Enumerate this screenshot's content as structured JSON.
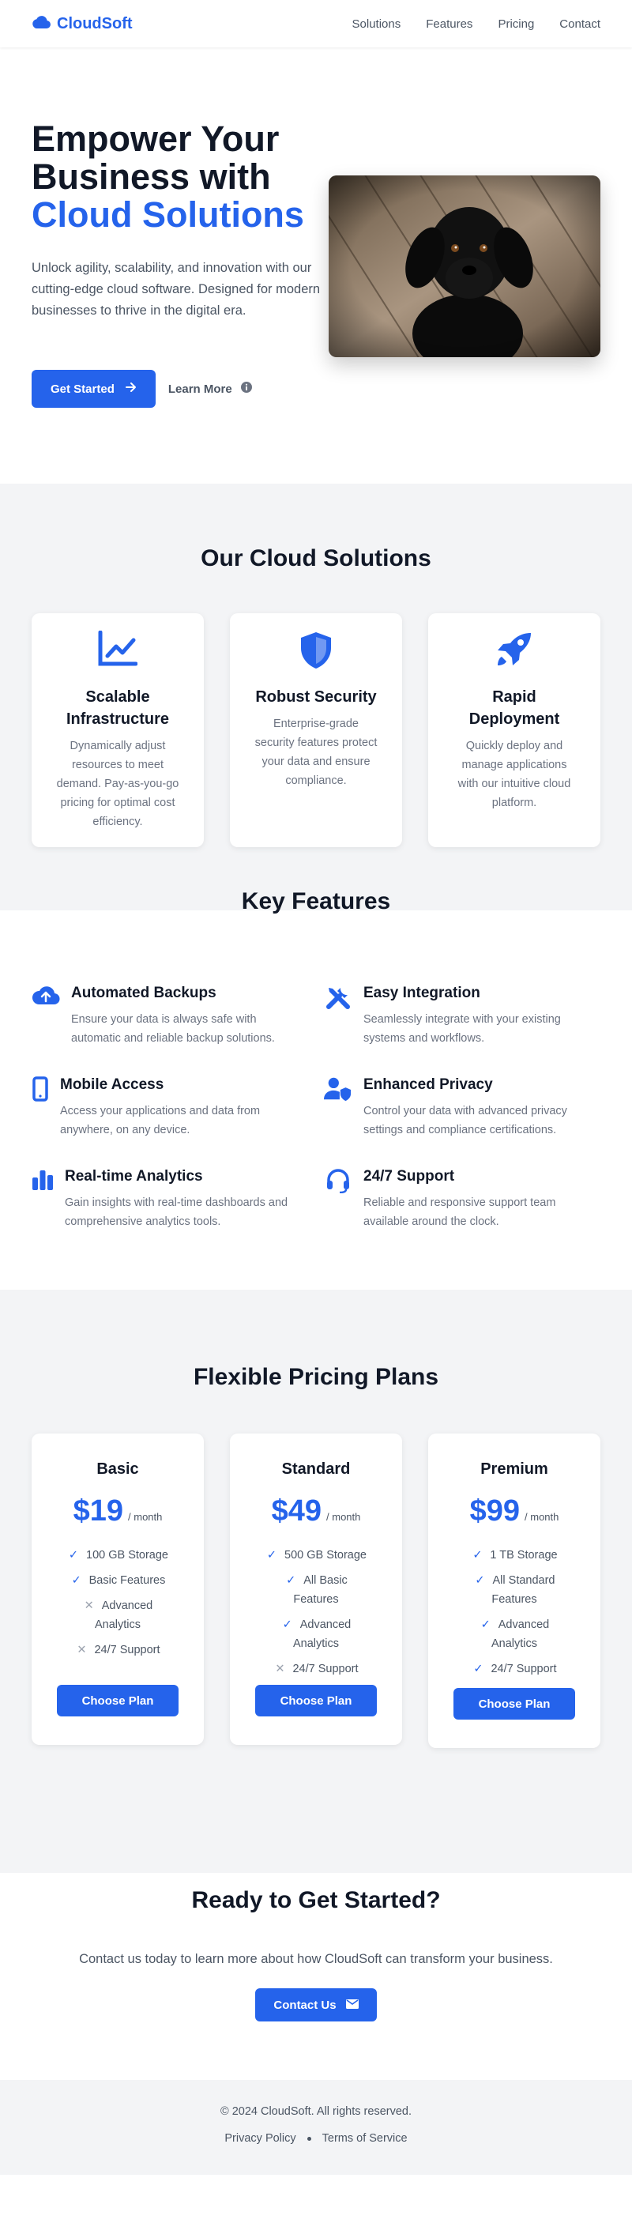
{
  "brand": {
    "name": "CloudSoft"
  },
  "nav": {
    "items": [
      "Solutions",
      "Features",
      "Pricing",
      "Contact"
    ]
  },
  "hero": {
    "title_line1": "Empower Your",
    "title_line2": "Business with",
    "title_accent": "Cloud Solutions",
    "description": "Unlock agility, scalability, and innovation with our cutting-edge cloud software. Designed for modern businesses to thrive in the digital era.",
    "primary_button": "Get Started",
    "secondary_button": "Learn More"
  },
  "solutions": {
    "title": "Our Cloud Solutions",
    "cards": [
      {
        "icon": "chart-line-icon",
        "title": "Scalable Infrastructure",
        "text": "Dynamically adjust resources to meet demand. Pay-as-you-go pricing for optimal cost efficiency."
      },
      {
        "icon": "shield-icon",
        "title": "Robust Security",
        "text": "Enterprise-grade security features protect your data and ensure compliance."
      },
      {
        "icon": "rocket-icon",
        "title": "Rapid Deployment",
        "text": "Quickly deploy and manage applications with our intuitive cloud platform."
      }
    ]
  },
  "features": {
    "title": "Key Features",
    "items": [
      {
        "icon": "cloud-upload-icon",
        "title": "Automated Backups",
        "text": "Ensure your data is always safe with automatic and reliable backup solutions."
      },
      {
        "icon": "tools-icon",
        "title": "Easy Integration",
        "text": "Seamlessly integrate with your existing systems and workflows."
      },
      {
        "icon": "mobile-icon",
        "title": "Mobile Access",
        "text": "Access your applications and data from anywhere, on any device."
      },
      {
        "icon": "user-shield-icon",
        "title": "Enhanced Privacy",
        "text": "Control your data with advanced privacy settings and compliance certifications."
      },
      {
        "icon": "bar-chart-icon",
        "title": "Real-time Analytics",
        "text": "Gain insights with real-time dashboards and comprehensive analytics tools."
      },
      {
        "icon": "headset-icon",
        "title": "24/7 Support",
        "text": "Reliable and responsive support team available around the clock."
      }
    ]
  },
  "pricing": {
    "title": "Flexible Pricing Plans",
    "unit": "/ month",
    "button": "Choose Plan",
    "plans": [
      {
        "name": "Basic",
        "price": "$19",
        "features": [
          {
            "text": "100 GB Storage",
            "included": true
          },
          {
            "text": "Basic Features",
            "included": true
          },
          {
            "text": "Advanced Analytics",
            "included": false
          },
          {
            "text": "24/7 Support",
            "included": false
          }
        ]
      },
      {
        "name": "Standard",
        "price": "$49",
        "features": [
          {
            "text": "500 GB Storage",
            "included": true
          },
          {
            "text": "All Basic Features",
            "included": true
          },
          {
            "text": "Advanced Analytics",
            "included": true
          },
          {
            "text": "24/7 Support",
            "included": false
          }
        ]
      },
      {
        "name": "Premium",
        "price": "$99",
        "features": [
          {
            "text": "1 TB Storage",
            "included": true
          },
          {
            "text": "All Standard Features",
            "included": true
          },
          {
            "text": "Advanced Analytics",
            "included": true
          },
          {
            "text": "24/7 Support",
            "included": true
          }
        ]
      }
    ]
  },
  "cta": {
    "title": "Ready to Get Started?",
    "description": "Contact us today to learn more about how CloudSoft can transform your business.",
    "button": "Contact Us"
  },
  "footer": {
    "copyright": "© 2024 CloudSoft. All rights reserved.",
    "links": [
      "Privacy Policy",
      "Terms of Service"
    ]
  },
  "colors": {
    "accent": "#2563eb",
    "muted_bg": "#f3f4f6",
    "heading": "#111827",
    "text": "#4b5563"
  }
}
